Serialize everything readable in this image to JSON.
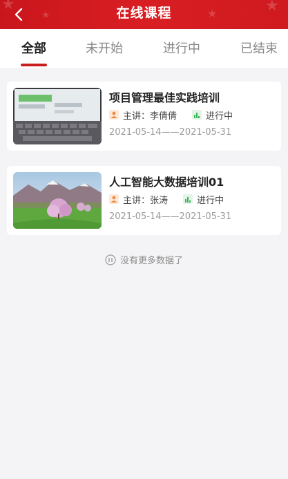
{
  "header": {
    "title": "在线课程",
    "back_icon": "chevron-left-icon",
    "background": "#d0191e"
  },
  "tabs": [
    {
      "label": "全部",
      "active": true
    },
    {
      "label": "未开始",
      "active": false
    },
    {
      "label": "进行中",
      "active": false
    },
    {
      "label": "已结束",
      "active": false
    }
  ],
  "courses": [
    {
      "title": "项目管理最佳实践培训",
      "lecturer": "主讲：李倩倩",
      "status": "进行中",
      "dates": "2021-05-14——2021-05-31",
      "thumbnail": "laptop-screen-image"
    },
    {
      "title": "人工智能大数据培训01",
      "lecturer": "主讲：张涛",
      "status": "进行中",
      "dates": "2021-05-14——2021-05-31",
      "thumbnail": "blossom-landscape-image"
    }
  ],
  "footer": {
    "no_more": "没有更多数据了"
  },
  "colors": {
    "accent": "#c81e1e",
    "lecturer_icon": "#f08a3c",
    "status_icon": "#3cb45a"
  }
}
